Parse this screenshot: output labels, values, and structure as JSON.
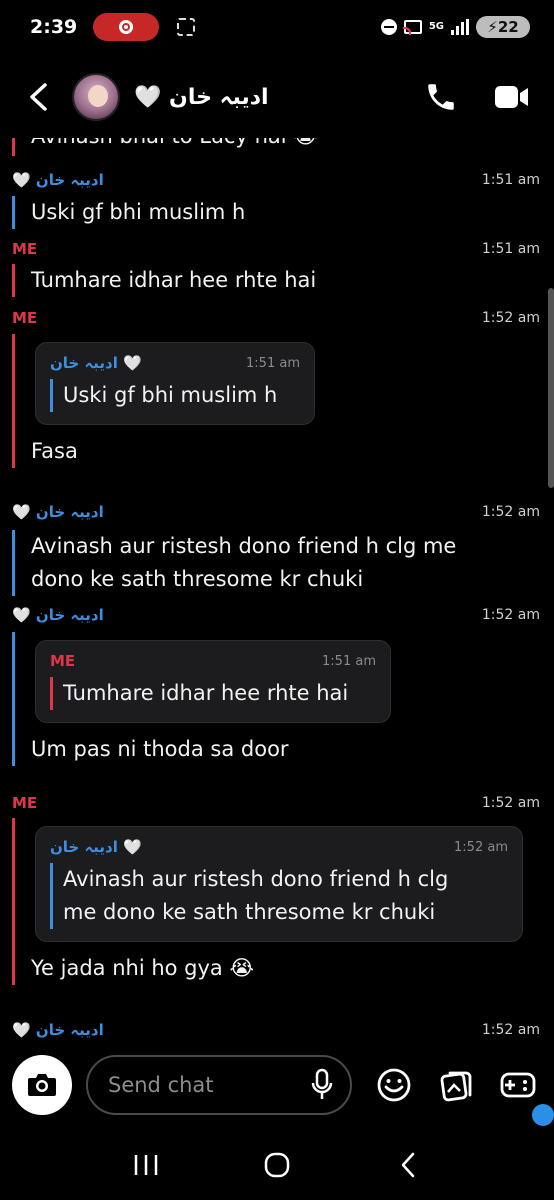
{
  "status_bar": {
    "time": "2:39",
    "network": "5G",
    "battery": "22"
  },
  "header": {
    "contact_name": "ادیبہ خان 🤍",
    "icons": [
      "back-chevron-icon",
      "phone-icon",
      "video-camera-icon"
    ]
  },
  "messages": [
    {
      "text": "Avinash bhai to Lucy hai 😭",
      "side": "me"
    },
    {
      "sender": "ادیبہ خان 🤍",
      "side": "them",
      "time": "1:51 am",
      "text": "Uski gf bhi muslim h"
    },
    {
      "sender": "ME",
      "side": "me",
      "time": "1:51 am",
      "text": "Tumhare idhar hee rhte hai"
    },
    {
      "sender": "ME",
      "side": "me",
      "time": "1:52 am",
      "quote": {
        "sender": "🤍 ادیبہ خان",
        "side": "them",
        "time": "1:51 am",
        "text": "Uski gf bhi muslim h"
      },
      "text": "Fasa"
    },
    {
      "sender": "ادیبہ خان 🤍",
      "side": "them",
      "time": "1:52 am",
      "text_lines": [
        "Avinash aur ristesh dono friend h clg me",
        "dono ke sath thresome kr chuki"
      ]
    },
    {
      "sender": "ادیبہ خان 🤍",
      "side": "them",
      "time": "1:52 am",
      "quote": {
        "sender": "ME",
        "side": "me",
        "time": "1:51 am",
        "text": "Tumhare idhar hee rhte hai"
      },
      "text": "Um pas ni thoda sa door"
    },
    {
      "sender": "ME",
      "side": "me",
      "time": "1:52 am",
      "quote": {
        "sender": "🤍 ادیبہ خان",
        "side": "them",
        "time": "1:52 am",
        "text_lines": [
          "Avinash aur ristesh dono friend h clg",
          "me dono ke sath thresome kr chuki"
        ]
      },
      "text": "Ye jada nhi ho gya 😭"
    },
    {
      "sender": "ادیبہ خان 🤍",
      "side": "them",
      "time": "1:52 am"
    }
  ],
  "composer": {
    "placeholder": "Send chat",
    "icons": [
      "camera-icon",
      "microphone-icon",
      "emoji-icon",
      "memories-icon",
      "game-controller-icon"
    ]
  },
  "nav": {
    "icons": [
      "recent-apps-icon",
      "home-icon",
      "back-icon"
    ]
  },
  "colors": {
    "me": "#e0364a",
    "them": "#3d8fe0",
    "background": "#000000",
    "quote_bg": "#1c1c1e"
  }
}
